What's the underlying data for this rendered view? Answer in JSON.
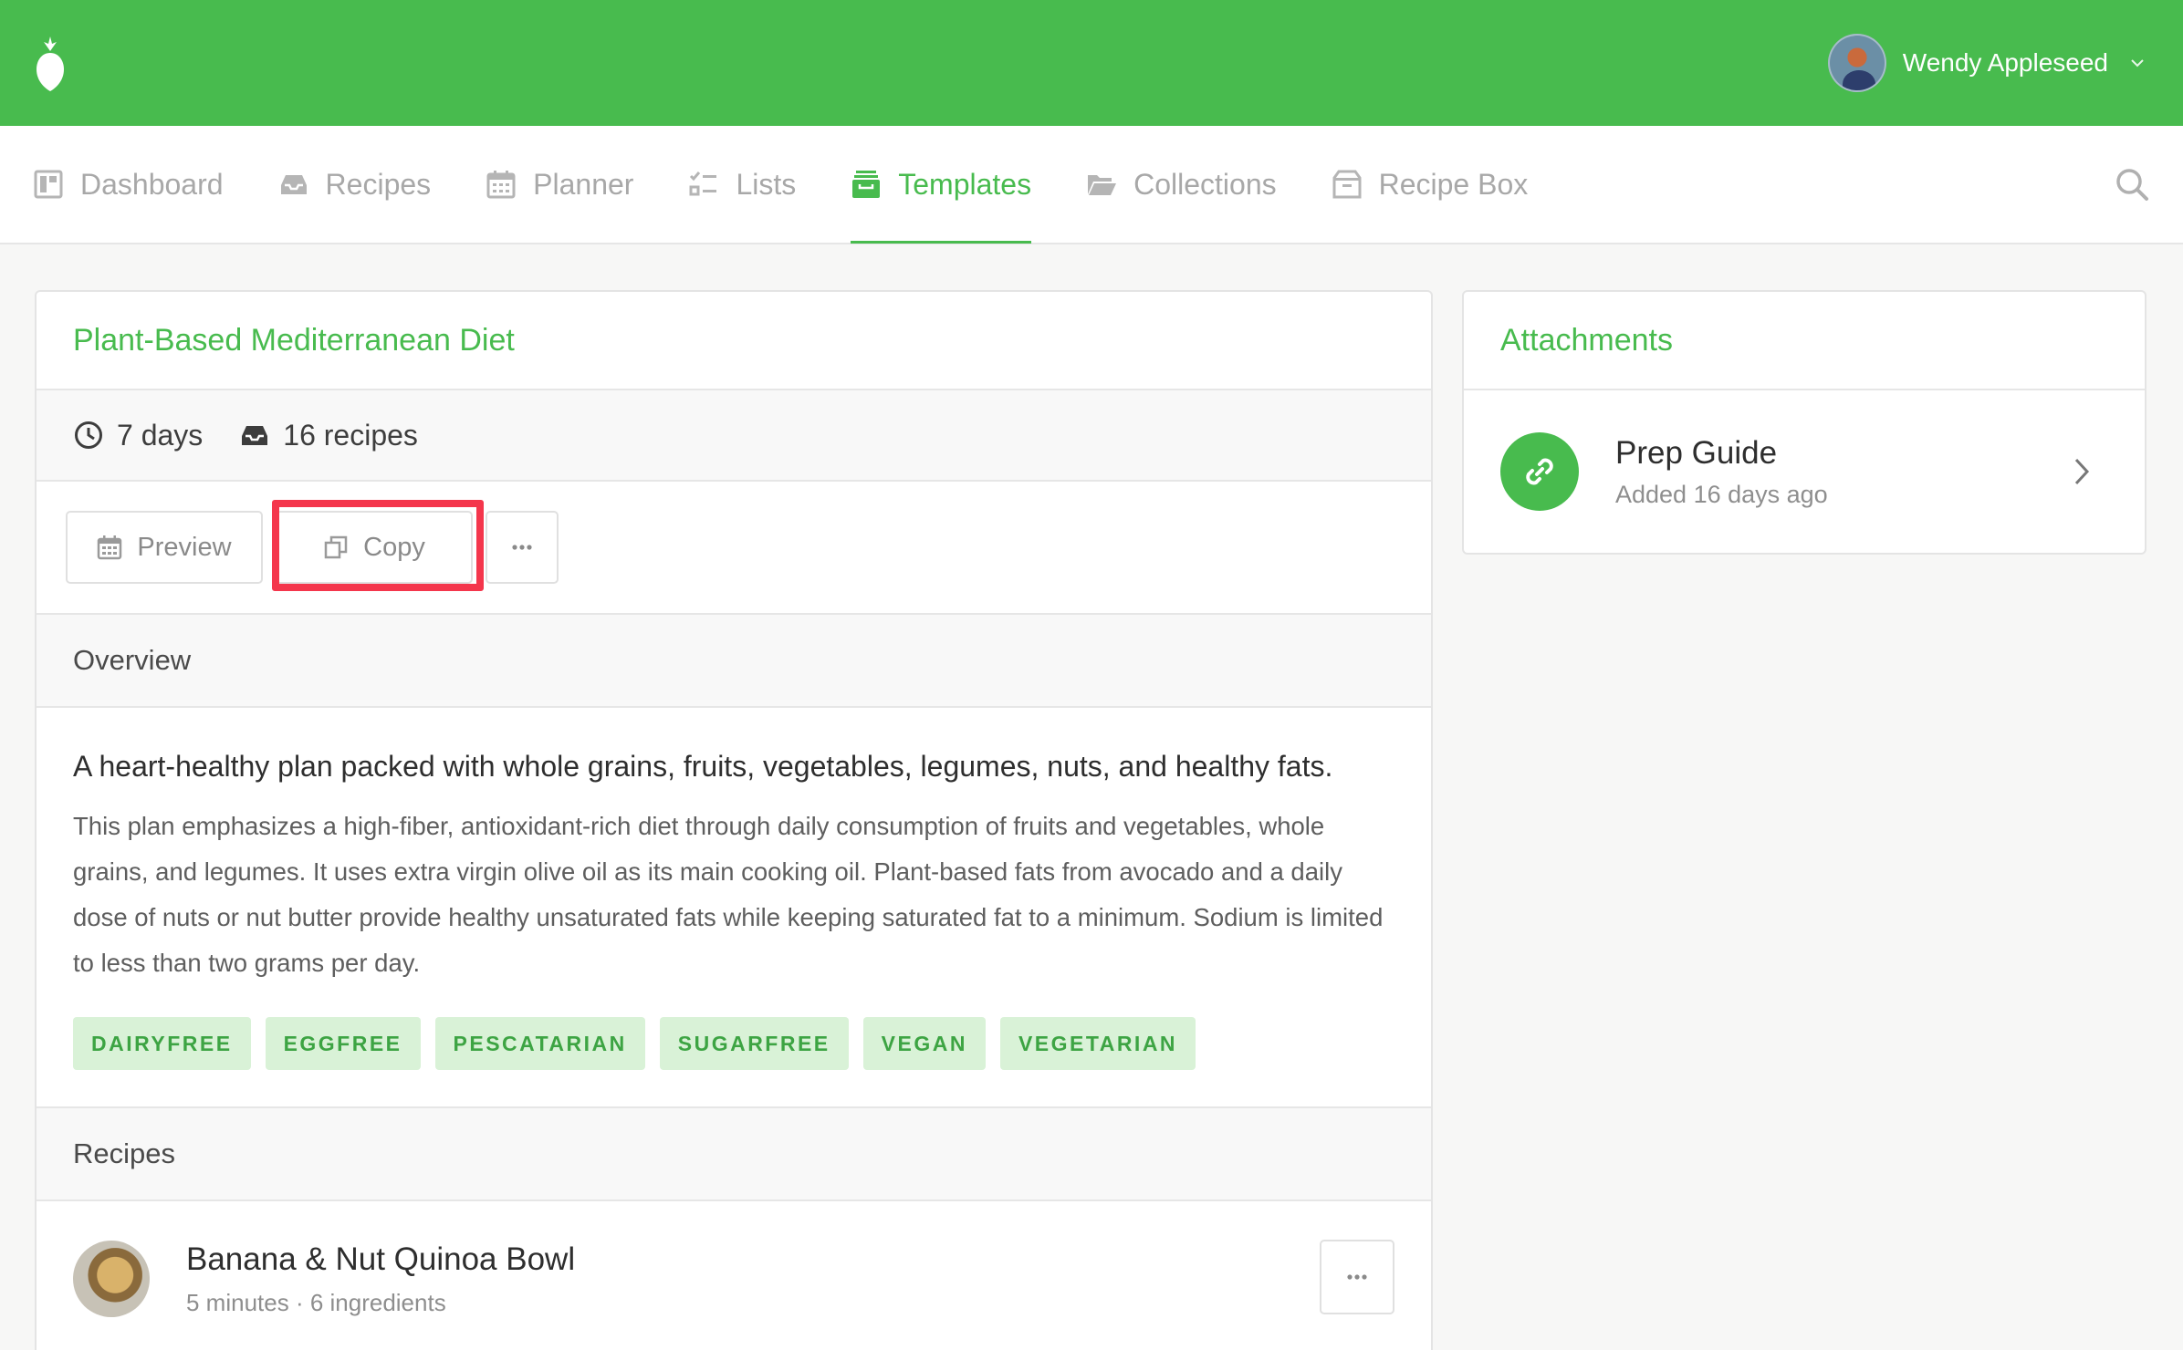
{
  "header": {
    "user_name": "Wendy Appleseed"
  },
  "nav": {
    "items": [
      {
        "label": "Dashboard",
        "icon": "dashboard-icon"
      },
      {
        "label": "Recipes",
        "icon": "inbox-icon"
      },
      {
        "label": "Planner",
        "icon": "calendar-icon"
      },
      {
        "label": "Lists",
        "icon": "checklist-icon"
      },
      {
        "label": "Templates",
        "icon": "archive-icon",
        "active": true
      },
      {
        "label": "Collections",
        "icon": "folder-icon"
      },
      {
        "label": "Recipe Box",
        "icon": "box-icon"
      }
    ]
  },
  "template": {
    "title": "Plant-Based Mediterranean Diet",
    "duration": "7 days",
    "recipe_count": "16 recipes",
    "actions": {
      "preview_label": "Preview",
      "copy_label": "Copy"
    },
    "overview_heading": "Overview",
    "lead": "A heart-healthy plan packed with whole grains, fruits, vegetables, legumes, nuts, and healthy fats.",
    "description": "This plan emphasizes a high-fiber, antioxidant-rich diet through daily consumption of fruits and vegetables, whole grains, and legumes. It uses extra virgin olive oil as its main cooking oil. Plant-based fats from avocado and a daily dose of nuts or nut butter provide healthy unsaturated fats while keeping saturated fat to a minimum. Sodium is limited to less than two grams per day.",
    "tags": [
      "DAIRYFREE",
      "EGGFREE",
      "PESCATARIAN",
      "SUGARFREE",
      "VEGAN",
      "VEGETARIAN"
    ],
    "recipes_heading": "Recipes",
    "recipes": [
      {
        "name": "Banana & Nut Quinoa Bowl",
        "meta": "5 minutes · 6 ingredients"
      }
    ]
  },
  "attachments": {
    "heading": "Attachments",
    "items": [
      {
        "name": "Prep Guide",
        "added": "Added 16 days ago"
      }
    ]
  },
  "colors": {
    "brand_green": "#48bb4e",
    "highlight_red": "#f4364c",
    "tag_bg": "#d9f2d7"
  }
}
